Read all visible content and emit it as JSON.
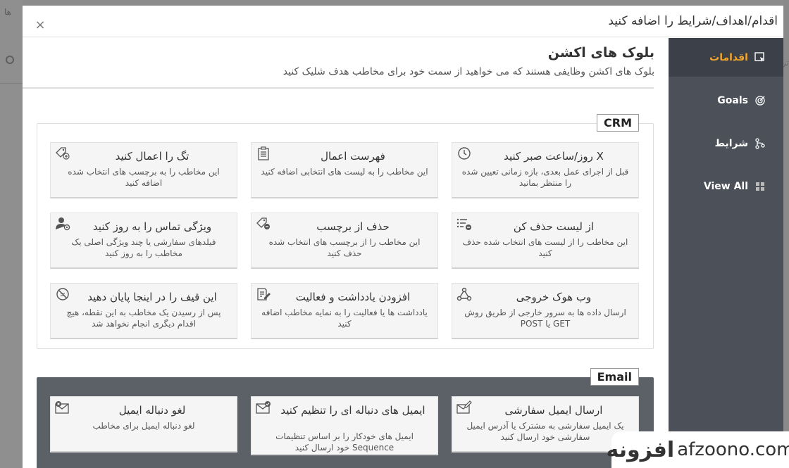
{
  "background": {
    "left_text": "ها",
    "right_text": "تر"
  },
  "modal": {
    "title": "اقدام/اهداف/شرایط را اضافه کنید",
    "close": "×"
  },
  "sidebar": {
    "items": [
      {
        "label": "اقدامات",
        "icon": "cursor-box-icon",
        "active": true
      },
      {
        "label": "Goals",
        "icon": "target-icon",
        "active": false
      },
      {
        "label": "شرایط",
        "icon": "branch-icon",
        "active": false
      },
      {
        "label": "View All",
        "icon": "grid-icon",
        "active": false
      }
    ]
  },
  "section": {
    "title": "بلوک های اکشن",
    "description": "بلوک های اکشن وظایفی هستند که می خواهید از سمت خود برای مخاطب هدف شلیک کنید"
  },
  "groups": {
    "crm": {
      "label": "CRM",
      "cards": [
        {
          "title": "X روز/ساعت صبر کنید",
          "desc": "قبل از اجرای عمل بعدی، بازه زمانی تعیین شده را منتظر بمانید",
          "icon": "clock-icon"
        },
        {
          "title": "فهرست اعمال",
          "desc": "این مخاطب را به لیست های انتخابی اضافه کنید",
          "icon": "clipboard-list-icon"
        },
        {
          "title": "تگ را اعمال کنید",
          "desc": "این مخاطب را به برچسب های انتخاب شده اضافه کنید",
          "icon": "tag-plus-icon"
        },
        {
          "title": "از لیست حذف کن",
          "desc": "این مخاطب را از لیست های انتخاب شده حذف کنید",
          "icon": "list-remove-icon"
        },
        {
          "title": "حذف از برچسب",
          "desc": "این مخاطب را از برچسب های انتخاب شده حذف کنید",
          "icon": "tag-minus-icon"
        },
        {
          "title": "ویژگی تماس را به روز کنید",
          "desc": "فیلدهای سفارشی یا چند ویژگی اصلی یک مخاطب را به روز کنید",
          "icon": "user-gear-icon"
        },
        {
          "title": "وب هوک خروجی",
          "desc": "ارسال داده ها به سرور خارجی از طریق روش GET یا POST",
          "icon": "webhook-icon"
        },
        {
          "title": "افزودن یادداشت و فعالیت",
          "desc": "یادداشت ها یا فعالیت را به نمایه مخاطب اضافه کنید",
          "icon": "note-edit-icon"
        },
        {
          "title": "این قیف را در اینجا پایان دهید",
          "desc": "پس از رسیدن یک مخاطب به این نقطه، هیچ اقدام دیگری انجام نخواهد شد",
          "icon": "stop-circle-icon"
        }
      ]
    },
    "email": {
      "label": "Email",
      "cards": [
        {
          "title": "ارسال ایمیل سفارشی",
          "desc": "یک ایمیل سفارشی به مشترک یا آدرس ایمیل سفارشی خود ارسال کنید",
          "icon": "email-edit-icon"
        },
        {
          "title": "ایمیل های دنباله ای را تنظیم کنید",
          "desc": "ایمیل های خودکار را بر اساس تنظیمات Sequence خود ارسال کنید",
          "icon": "email-check-icon"
        },
        {
          "title": "لغو دنباله ایمیل",
          "desc": "لغو دنباله ایمیل برای مخاطب",
          "icon": "email-cancel-icon"
        }
      ]
    }
  },
  "watermark": {
    "fa": "افزونه",
    "en": "afzoono.com"
  },
  "colors": {
    "accent": "#f4a62a",
    "sidebar": "#4b5059",
    "sidebar_active": "#3c4048"
  }
}
